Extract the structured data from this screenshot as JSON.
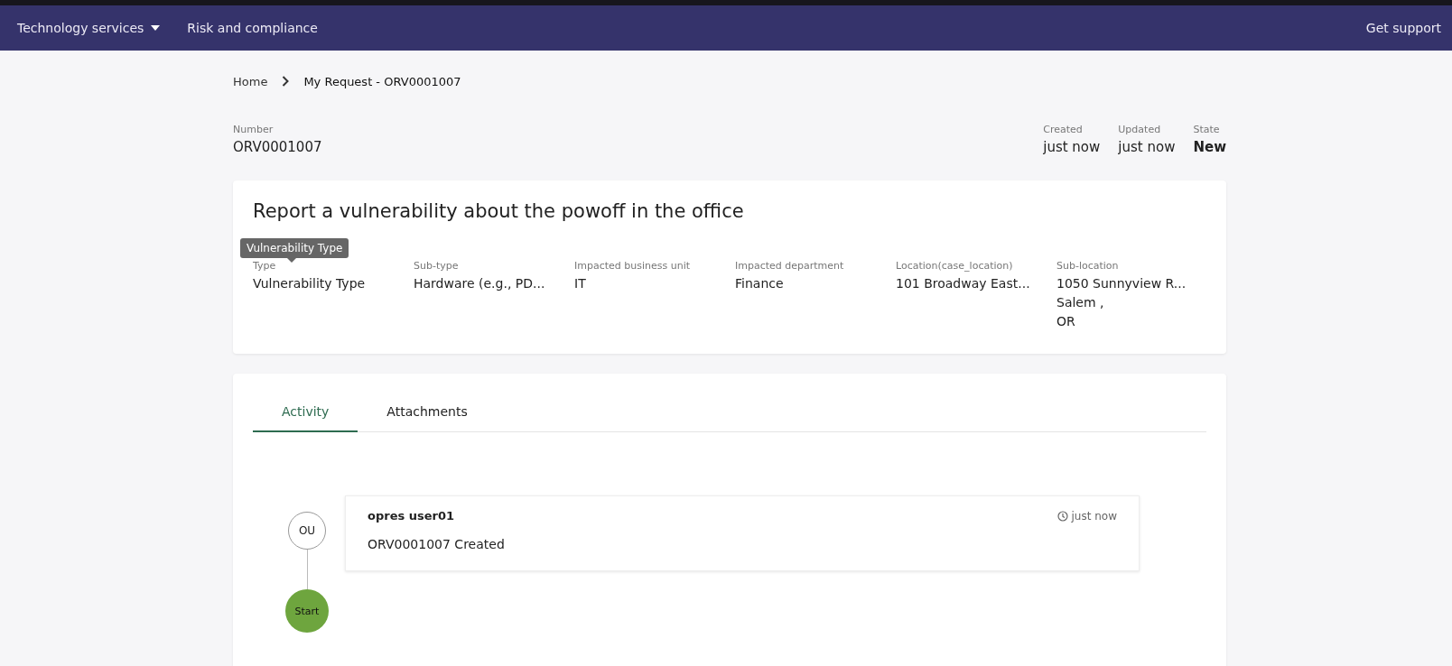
{
  "nav": {
    "items": [
      {
        "label": "Technology services",
        "dropdown": true
      },
      {
        "label": "Risk and compliance",
        "dropdown": false
      }
    ],
    "support": "Get support"
  },
  "breadcrumb": [
    "Home",
    "My Request - ORV0001007"
  ],
  "header": {
    "number_label": "Number",
    "number": "ORV0001007",
    "meta": [
      {
        "label": "Created",
        "value": "just now",
        "bold": false
      },
      {
        "label": "Updated",
        "value": "just now",
        "bold": false
      },
      {
        "label": "State",
        "value": "New",
        "bold": true
      }
    ]
  },
  "summary": {
    "title": "Report a vulnerability about the powoff in the office",
    "tooltip": "Vulnerability Type",
    "fields": [
      {
        "label": "Type",
        "lines": [
          "Vulnerability Type"
        ]
      },
      {
        "label": "Sub-type",
        "lines": [
          "Hardware (e.g., PD..."
        ]
      },
      {
        "label": "Impacted business unit",
        "lines": [
          "IT"
        ]
      },
      {
        "label": "Impacted department",
        "lines": [
          "Finance"
        ]
      },
      {
        "label": "Location(case_location)",
        "lines": [
          "101 Broadway East..."
        ]
      },
      {
        "label": "Sub-location",
        "lines": [
          "1050 Sunnyview R...",
          "Salem ,",
          "OR"
        ]
      }
    ]
  },
  "tabs": [
    {
      "label": "Activity",
      "selected": true
    },
    {
      "label": "Attachments",
      "selected": false
    }
  ],
  "activity": [
    {
      "kind": "entry",
      "avatar": "OU",
      "user": "opres user01",
      "time": "just now",
      "text": "ORV0001007 Created"
    },
    {
      "kind": "start",
      "avatar": "Start"
    }
  ]
}
